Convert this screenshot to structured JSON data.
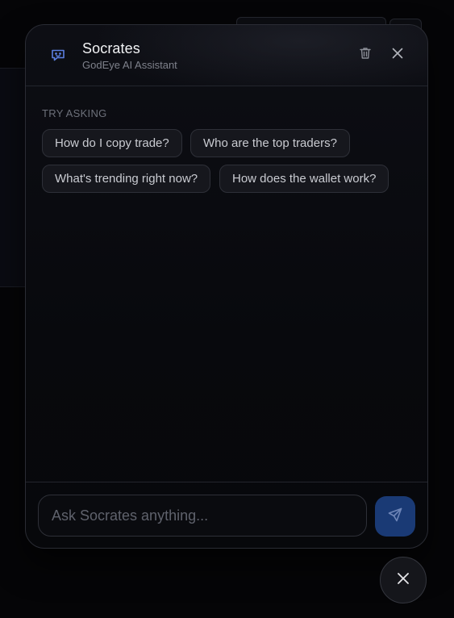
{
  "assistant": {
    "name": "Socrates",
    "subtitle": "GodEye AI Assistant"
  },
  "suggestions": {
    "label": "TRY ASKING",
    "items": [
      "How do I copy trade?",
      "Who are the top traders?",
      "What's trending right now?",
      "How does the wallet work?"
    ]
  },
  "composer": {
    "placeholder": "Ask Socrates anything...",
    "value": ""
  },
  "icons": {
    "header": "bot-icon",
    "clear": "trash-icon",
    "close": "close-icon",
    "send": "send-icon",
    "fab": "close-icon"
  },
  "colors": {
    "accent": "#1a3a75",
    "icon_accent": "#5b7fe0",
    "panel_bg": "#0d0e14",
    "text_primary": "#f2f3f5",
    "text_muted": "#7e818b"
  }
}
